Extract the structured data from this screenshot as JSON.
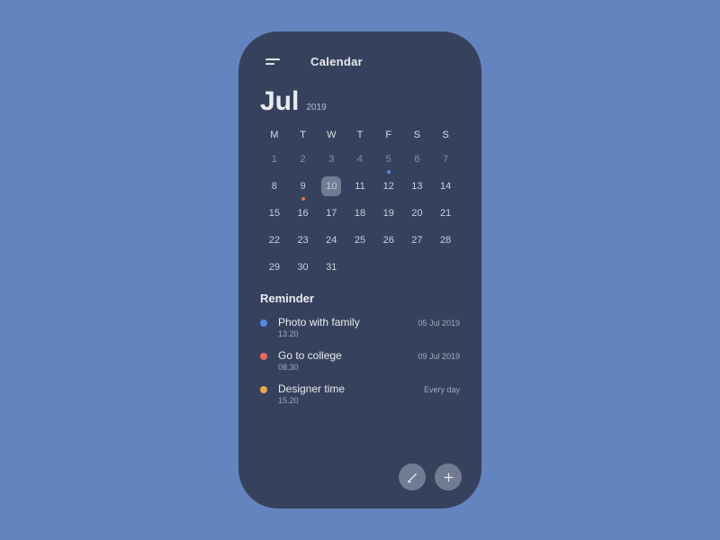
{
  "header": {
    "title": "Calendar"
  },
  "calendar": {
    "month": "Jul",
    "year": "2019",
    "dow": [
      "M",
      "T",
      "W",
      "T",
      "F",
      "S",
      "S"
    ],
    "selected_day": 10,
    "days": [
      {
        "n": "1",
        "dim": true
      },
      {
        "n": "2",
        "dim": true
      },
      {
        "n": "3",
        "dim": true
      },
      {
        "n": "4",
        "dim": true
      },
      {
        "n": "5",
        "dim": true,
        "dot": "#5a87e2"
      },
      {
        "n": "6",
        "dim": true
      },
      {
        "n": "7",
        "dim": true
      },
      {
        "n": "8"
      },
      {
        "n": "9",
        "dot": "#e66a5e"
      },
      {
        "n": "10",
        "selected": true
      },
      {
        "n": "11"
      },
      {
        "n": "12"
      },
      {
        "n": "13"
      },
      {
        "n": "14"
      },
      {
        "n": "15"
      },
      {
        "n": "16"
      },
      {
        "n": "17"
      },
      {
        "n": "18"
      },
      {
        "n": "19"
      },
      {
        "n": "20"
      },
      {
        "n": "21"
      },
      {
        "n": "22"
      },
      {
        "n": "23"
      },
      {
        "n": "24"
      },
      {
        "n": "25"
      },
      {
        "n": "26"
      },
      {
        "n": "27"
      },
      {
        "n": "28"
      },
      {
        "n": "29"
      },
      {
        "n": "30"
      },
      {
        "n": "31"
      },
      {
        "n": ""
      },
      {
        "n": ""
      },
      {
        "n": ""
      },
      {
        "n": ""
      }
    ]
  },
  "reminder_heading": "Reminder",
  "reminders": [
    {
      "color": "#5a87e2",
      "title": "Photo with family",
      "time": "13.20",
      "date": "05 Jul 2019"
    },
    {
      "color": "#e66a5e",
      "title": "Go to college",
      "time": "08.30",
      "date": "09 Jul 2019"
    },
    {
      "color": "#e7a94b",
      "title": "Designer time",
      "time": "15.20",
      "date": "Every day"
    }
  ]
}
